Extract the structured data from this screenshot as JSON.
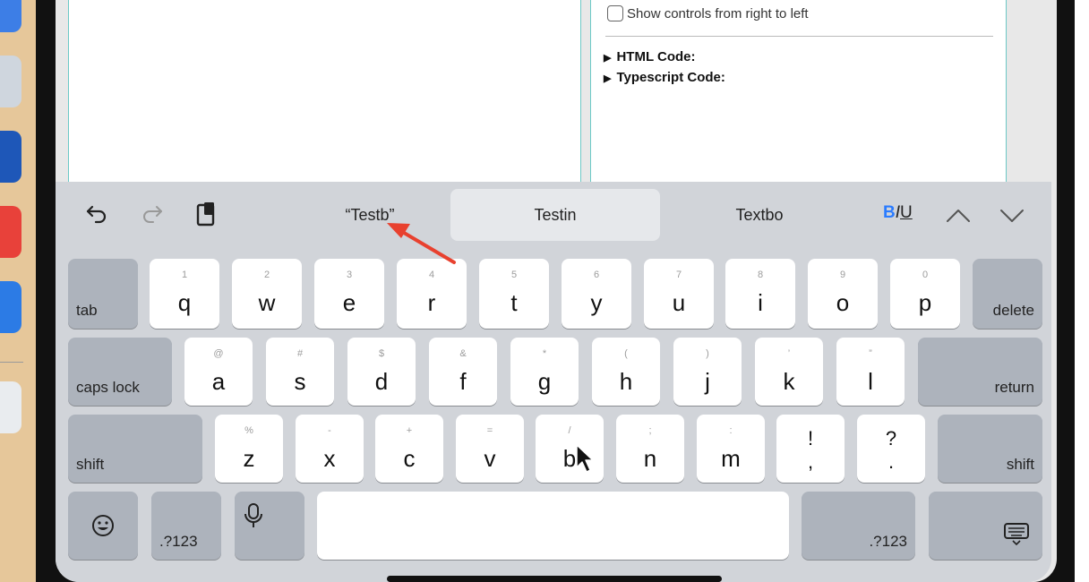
{
  "dock": {
    "icons": [
      "finder-icon",
      "preview-icon",
      "finder-face-icon",
      "app-red-icon",
      "xcode-icon",
      "trash-icon"
    ]
  },
  "panel_right": {
    "rtl_checkbox_label": "Show controls from right to left",
    "html_code_label": "HTML Code:",
    "typescript_code_label": "Typescript Code:"
  },
  "toolbar": {
    "suggestions": [
      "“Testb”",
      "Testin",
      "Textbo"
    ],
    "bold": "B",
    "italic": "I",
    "underline": "U"
  },
  "keyboard": {
    "row1": [
      {
        "alt": "1",
        "main": "q"
      },
      {
        "alt": "2",
        "main": "w"
      },
      {
        "alt": "3",
        "main": "e"
      },
      {
        "alt": "4",
        "main": "r"
      },
      {
        "alt": "5",
        "main": "t"
      },
      {
        "alt": "6",
        "main": "y"
      },
      {
        "alt": "7",
        "main": "u"
      },
      {
        "alt": "8",
        "main": "i"
      },
      {
        "alt": "9",
        "main": "o"
      },
      {
        "alt": "0",
        "main": "p"
      }
    ],
    "row2": [
      {
        "alt": "@",
        "main": "a"
      },
      {
        "alt": "#",
        "main": "s"
      },
      {
        "alt": "$",
        "main": "d"
      },
      {
        "alt": "&",
        "main": "f"
      },
      {
        "alt": "*",
        "main": "g"
      },
      {
        "alt": "(",
        "main": "h"
      },
      {
        "alt": ")",
        "main": "j"
      },
      {
        "alt": "’",
        "main": "k"
      },
      {
        "alt": "”",
        "main": "l"
      }
    ],
    "row3": [
      {
        "alt": "%",
        "main": "z"
      },
      {
        "alt": "-",
        "main": "x"
      },
      {
        "alt": "+",
        "main": "c"
      },
      {
        "alt": "=",
        "main": "v"
      },
      {
        "alt": "/",
        "main": "b"
      },
      {
        "alt": ";",
        "main": "n"
      },
      {
        "alt": ":",
        "main": "m"
      }
    ],
    "punct": [
      {
        "top": "!",
        "bottom": ","
      },
      {
        "top": "?",
        "bottom": "."
      }
    ],
    "tab": "tab",
    "delete": "delete",
    "caps_lock": "caps lock",
    "return": "return",
    "shift_left": "shift",
    "shift_right": "shift",
    "numbers_left": ".?123",
    "numbers_right": ".?123"
  },
  "colors": {
    "accent_bold": "#2b7cff",
    "annotation_arrow": "#e8412f",
    "panel_border": "#6cc9c6"
  }
}
